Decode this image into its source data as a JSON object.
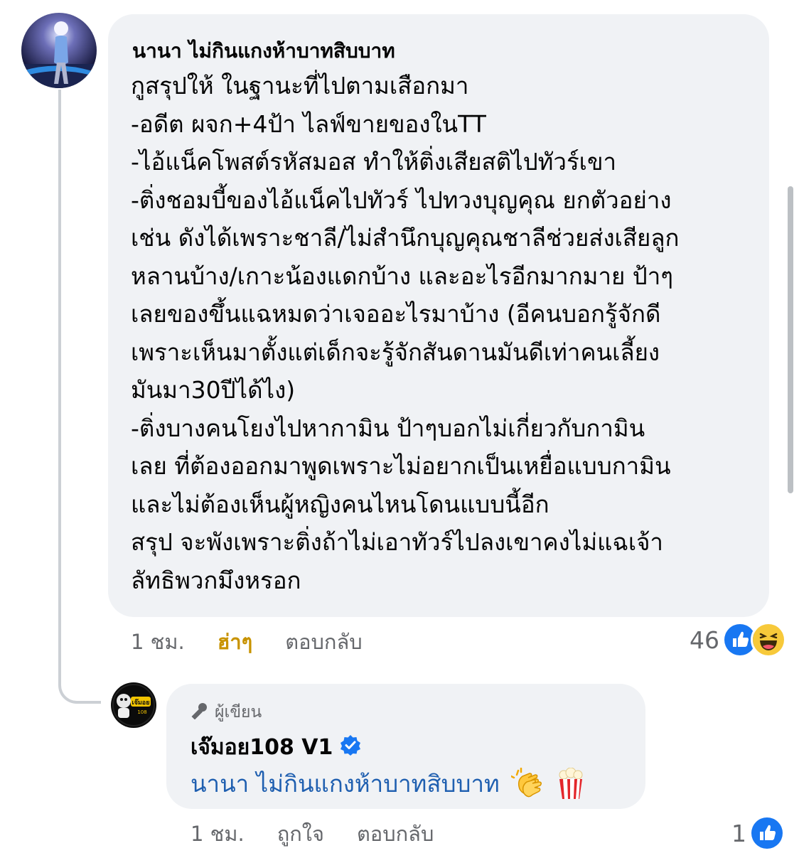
{
  "comment": {
    "author": "นานา ไม่กินแกงห้าบาทสิบบาท",
    "lines": [
      "กูสรุปให้ ในฐานะที่ไปตามเสือกมา",
      "-อดีต ผจก+4ป้า ไลฟ์ขายของในTT",
      "-ไอ้แน็คโพสต์รหัสมอส ทำให้ติ่งเสียสติไปทัวร์เขา",
      "-ติ่งชอมบี้ของไอ้แน็คไปทัวร์ ไปทวงบุญคุณ ยกตัวอย่าง",
      "เช่น ดังได้เพราะชาลี/ไม่สำนึกบุญคุณชาลีช่วยส่งเสียลูก",
      "หลานบ้าง/เกาะน้องแดกบ้าง และอะไรอีกมากมาย ป้าๆ",
      "เลยของขึ้นแฉหมดว่าเจออะไรมาบ้าง (อีคนบอกรู้จักดี",
      "เพราะเห็นมาตั้งแต่เด็กจะรู้จักสันดานมันดีเท่าคนเลี้ยง",
      "มันมา30ปีได้ไง)",
      "-ติ่งบางคนโยงไปหากามิน ป้าๆบอกไม่เกี่ยวกับกามิน",
      "เลย ที่ต้องออกมาพูดเพราะไม่อยากเป็นเหยื่อแบบกามิน",
      "และไม่ต้องเห็นผู้หญิงคนไหนโดนแบบนี้อีก",
      "สรุป จะพังเพราะติ่งถ้าไม่เอาทัวร์ไปลงเขาคงไม่แฉเจ้า",
      "ลัทธิพวกมึงหรอก"
    ],
    "actions": {
      "time": "1 ชม.",
      "reaction_label": "ฮ่าๆ",
      "reply_label": "ตอบกลับ"
    },
    "reaction_count": "46"
  },
  "reply": {
    "badge": "ผู้เขียน",
    "author": "เจ๊มอย108 V1",
    "mention": "นานา ไม่กินแกงห้าบาทสิบบาท",
    "actions": {
      "time": "1 ชม.",
      "like_label": "ถูกใจ",
      "reply_label": "ตอบกลับ"
    },
    "reaction_count": "1",
    "avatar_text": "เจ๊มอย"
  },
  "colors": {
    "bubble": "#f0f2f5",
    "secondary_text": "#65676b",
    "haha_reacted": "#c89300",
    "mention": "#1f5fb0",
    "like_blue": "#1877f2"
  },
  "icons": {
    "like": "like-reaction-icon",
    "haha": "haha-reaction-icon",
    "mic": "microphone-icon",
    "verified": "verified-badge-icon",
    "clap": "clapping-hands-emoji",
    "popcorn": "popcorn-emoji"
  }
}
